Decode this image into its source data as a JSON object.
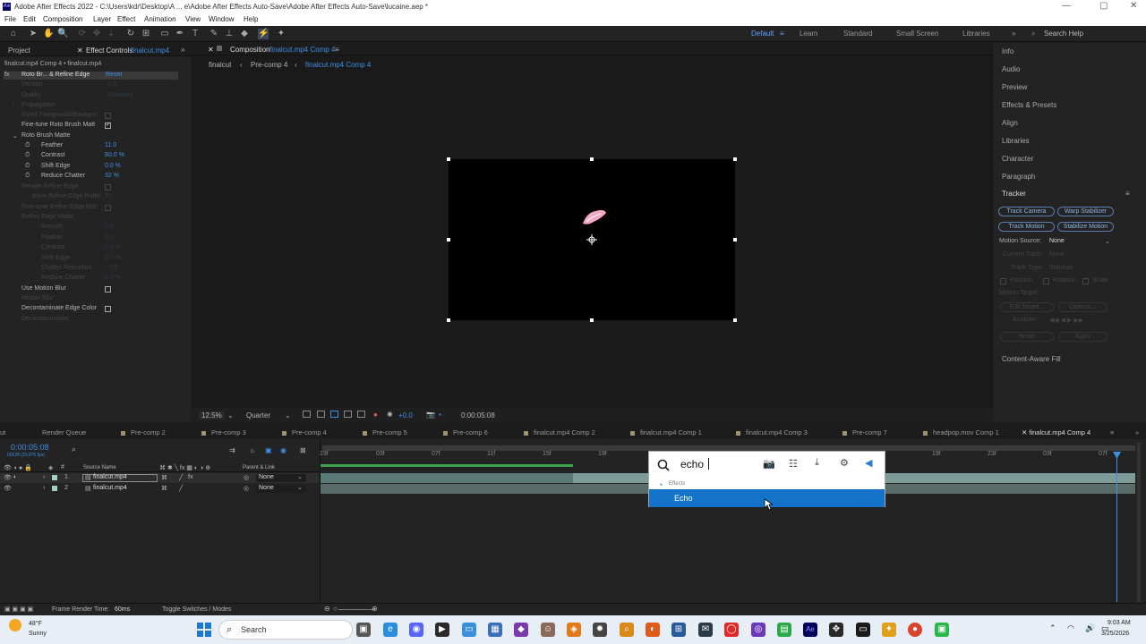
{
  "app": {
    "title": "Adobe After Effects 2022 - C:\\Users\\kdr\\Desktop\\A ... e\\Adobe After Effects Auto-Save\\Adobe After Effects Auto-Save\\lucaine.aep *",
    "logo_text": "Ae"
  },
  "menu": [
    "File",
    "Edit",
    "Composition",
    "Layer",
    "Effect",
    "Animation",
    "View",
    "Window",
    "Help"
  ],
  "workspaces": {
    "default": "Default",
    "learn": "Learn",
    "standard": "Standard",
    "small_screen": "Small Screen",
    "libraries": "Libraries",
    "search_help": "Search Help"
  },
  "left_panel": {
    "tab_project": "Project",
    "tab_effect_controls": "Effect Controls",
    "effect_controls_layer": "finalcut.mp4",
    "layer_path": "finalcut.mp4 Comp 4 • finalcut.mp4",
    "effect_name": "Roto Br... & Refine Edge",
    "reset": "Reset",
    "properties": [
      {
        "label": "Version",
        "value": "2.0",
        "dim": true
      },
      {
        "label": "Quality",
        "value": "Standard",
        "dim": true
      },
      {
        "label": "Propagation",
        "value": "",
        "dim": true
      },
      {
        "label": "Invert Foreground/Backgro",
        "value": "",
        "dim": true
      },
      {
        "label": "Fine-tune Roto Brush Matt",
        "value": "",
        "dim": false
      },
      {
        "label": "Roto Brush Matte",
        "value": "",
        "dim": false
      },
      {
        "label": "Feather",
        "value": "11.0",
        "dim": false
      },
      {
        "label": "Contrast",
        "value": "80.0 %",
        "dim": false
      },
      {
        "label": "Shift Edge",
        "value": "0.0 %",
        "dim": false
      },
      {
        "label": "Reduce Chatter",
        "value": "32 %",
        "dim": false
      },
      {
        "label": "Render Refine Edge",
        "value": "",
        "dim": true
      },
      {
        "label": "Base Refine Edge Radiu",
        "value": "10",
        "dim": true
      },
      {
        "label": "Fine-tune Refine Edge Mat",
        "value": "",
        "dim": true
      },
      {
        "label": "Refine Edge Matte",
        "value": "",
        "dim": true
      },
      {
        "label": "Smooth",
        "value": "0.0",
        "dim": true
      },
      {
        "label": "Feather",
        "value": "0.0",
        "dim": true
      },
      {
        "label": "Contrast",
        "value": "0.0 %",
        "dim": true
      },
      {
        "label": "Shift Edge",
        "value": "0.0 %",
        "dim": true
      },
      {
        "label": "Chatter Reduction",
        "value": "Off",
        "dim": true
      },
      {
        "label": "Reduce Chatter",
        "value": "0.0 %",
        "dim": true
      },
      {
        "label": "Use Motion Blur",
        "value": "",
        "dim": false
      },
      {
        "label": "Motion Blur",
        "value": "",
        "dim": true
      },
      {
        "label": "Decontaminate Edge Color",
        "value": "",
        "dim": false
      },
      {
        "label": "Decontamination",
        "value": "",
        "dim": true
      }
    ]
  },
  "composition": {
    "tab_label": "Composition",
    "tab_name": "finalcut.mp4 Comp 4",
    "breadcrumbs": [
      "finalcut",
      "Pre-comp 4",
      "finalcut.mp4 Comp 4"
    ],
    "zoom": "12.5%",
    "resolution": "Quarter",
    "exposure": "+0.0",
    "timecode": "0:00:05:08"
  },
  "right_panel": {
    "items": [
      "Info",
      "Audio",
      "Preview",
      "Effects & Presets",
      "Align",
      "Libraries",
      "Character",
      "Paragraph"
    ],
    "tracker_title": "Tracker",
    "buttons": [
      "Track Camera",
      "Warp Stabilizer",
      "Track Motion",
      "Stabilize Motion"
    ],
    "motion_source_label": "Motion Source:",
    "motion_source_value": "None",
    "current_track": "Current Track:",
    "current_track_value": "None",
    "track_type": "Track Type:",
    "track_type_value": "Stabilize",
    "position": "Position",
    "rotation": "Rotation",
    "scale": "Scale",
    "motion_target": "Motion Target:",
    "edit_target": "Edit Target...",
    "options": "Options...",
    "analyze": "Analyze:",
    "reset": "Reset",
    "apply": "Apply",
    "content_aware_fill": "Content-Aware Fill"
  },
  "timeline": {
    "tabs": [
      "Render Queue",
      "Pre-comp 2",
      "Pre-comp 3",
      "Pre-comp 4",
      "Pre-comp 5",
      "Pre-comp 6",
      "finalcut.mp4 Comp 2",
      "finalcut.mp4 Comp 1",
      "finalcut.mp4 Comp 3",
      "Pre-comp 7",
      "headpop.mov Comp 1",
      "finalcut.mp4 Comp 4"
    ],
    "timecode": "0:00:05:08",
    "fps": "00128 (23.976 fps)",
    "col_source_name": "Source Name",
    "col_parent": "Parent & Link",
    "layers": [
      {
        "num": "1",
        "name": "finalcut.mp4",
        "parent": "None"
      },
      {
        "num": "2",
        "name": "finalcut.mp4",
        "parent": "None"
      }
    ],
    "ruler_labels": [
      "23f",
      "03f",
      "07f",
      "11f",
      "15f",
      "19f",
      "19f",
      "23f",
      "03f",
      "07f"
    ],
    "render_time_label": "Frame Render Time:",
    "render_time": "60ms",
    "toggle_label": "Toggle Switches / Modes"
  },
  "search_popup": {
    "query": "echo",
    "section": "Effects",
    "result": "Echo"
  },
  "taskbar": {
    "weather_temp": "48°F",
    "weather_text": "Sunny",
    "search": "Search",
    "time": "9:03 AM",
    "date": "3/25/2026"
  }
}
